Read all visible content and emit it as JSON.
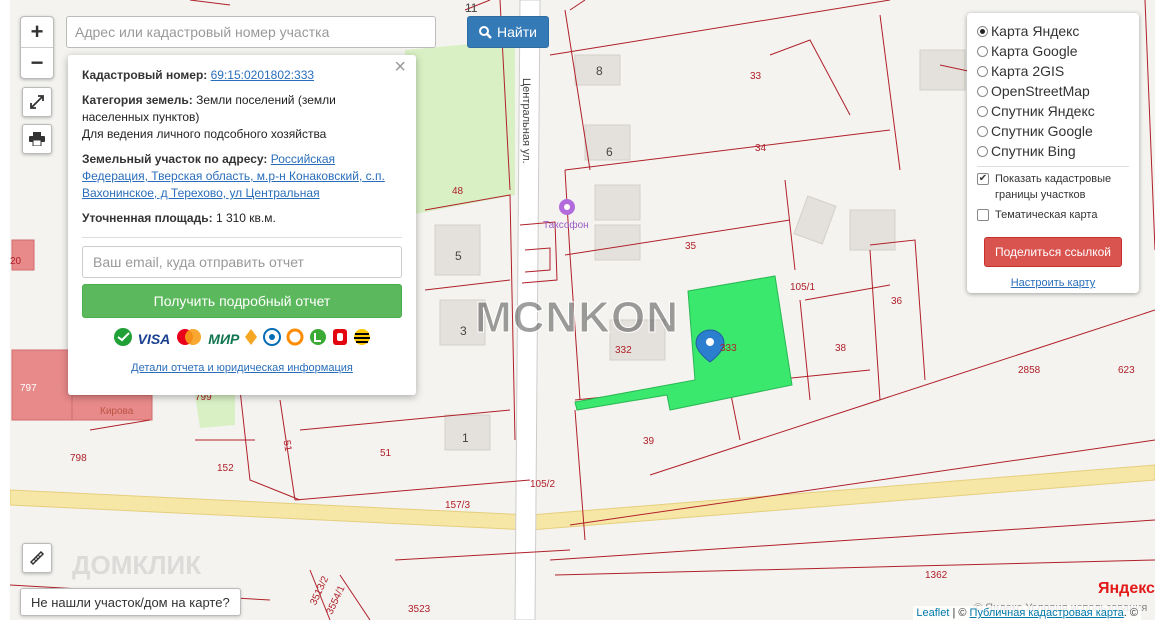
{
  "search": {
    "placeholder": "Адрес или кадастровый номер участка",
    "button_label": "Найти"
  },
  "zoom": {
    "in_label": "+",
    "out_label": "−"
  },
  "popup": {
    "close_label": "×",
    "cadastral_label": "Кадастровый номер:",
    "cadastral_value": "69:15:0201802:333",
    "category_label": "Категория земель:",
    "category_value": "Земли поселений (земли населенных пунктов)",
    "usage_value": "Для ведения личного подсобного хозяйства",
    "address_label": "Земельный участок по адресу:",
    "address_value": "Российская Федерация, Тверская область, м.р-н Конаковский, с.п. Вахонинское, д Терехово, ул Центральная",
    "area_label": "Уточненная площадь:",
    "area_value": "1 310 кв.м.",
    "email_placeholder": "Ваш email, куда отправить отчет",
    "report_button": "Получить подробный отчет",
    "payment_methods": [
      "sber-icon",
      "visa",
      "mastercard-icon",
      "mir",
      "yoomoney-icon",
      "webmoney-icon",
      "qiwi-icon",
      "yandex-money-icon",
      "mts-icon",
      "beeline-icon"
    ],
    "visa_label": "VISA",
    "mir_label": "МИР",
    "details_link": "Детали отчета и юридическая информация"
  },
  "layers": {
    "options": [
      "Карта Яндекс",
      "Карта Google",
      "Карта 2GIS",
      "OpenStreetMap",
      "Спутник Яндекс",
      "Спутник Google",
      "Спутник Bing"
    ],
    "selected_index": 0,
    "show_borders_label": "Показать кадастровые границы участков",
    "show_borders_checked": true,
    "thematic_label": "Тематическая карта",
    "thematic_checked": false,
    "share_button": "Поделиться ссылкой",
    "configure_link": "Настроить карту"
  },
  "not_found_button": "Не нашли участок/дом на карте?",
  "attribution": {
    "leaflet": "Leaflet",
    "separator": " | © ",
    "pkk": "Публичная кадастровая карта",
    "suffix": ". ©"
  },
  "yandex": {
    "logo": "Яндекс",
    "terms": "© Яндекс  Условия использования"
  },
  "watermark": "MCNKON",
  "domklik": "ДОМКЛИК",
  "map": {
    "street_name": "Центральная ул.",
    "poi_name": "Таксофон",
    "parcel_labels": [
      "11",
      "8",
      "33",
      "6",
      "34",
      "48",
      "35",
      "105/1",
      "36",
      "5",
      "3",
      "332",
      "333",
      "38",
      "2858",
      "623",
      "797",
      "799",
      "1",
      "39",
      "798",
      "152",
      "51",
      "51",
      "105/2",
      "157/3",
      "1362",
      "3523",
      "3513/2",
      "3554/1",
      "20",
      "Кирова"
    ],
    "selected_parcel": "333",
    "colors": {
      "parcel_border": "#b0202a",
      "selected_fill": "#3be86e",
      "road": "#f7e7a6",
      "green": "#d9f0c4",
      "building": "#e4e1dc",
      "poi": "#b26bdc"
    }
  }
}
